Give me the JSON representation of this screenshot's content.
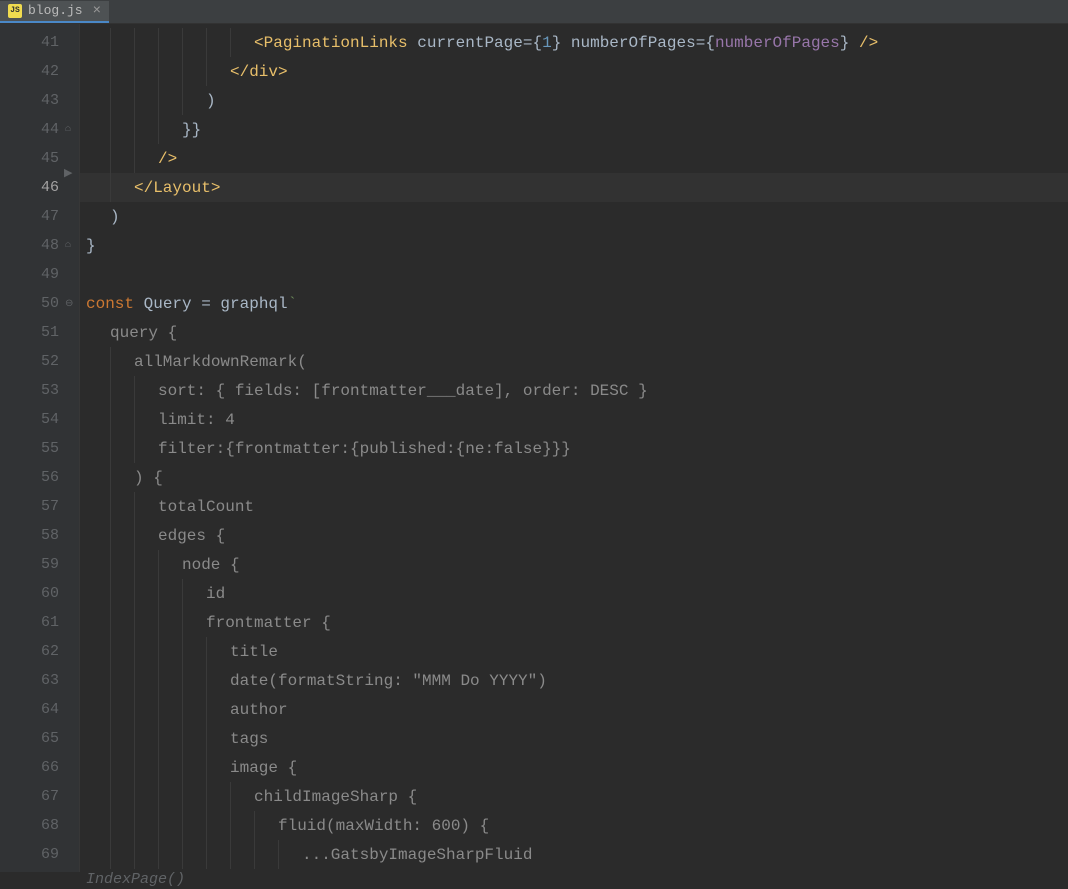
{
  "tab": {
    "filename": "blog.js",
    "icon_text": "JS"
  },
  "lines": {
    "start": 41,
    "end": 69,
    "current": 46
  },
  "code": {
    "l41": {
      "indent": 7,
      "tokens": [
        {
          "t": "<",
          "c": "c-tag"
        },
        {
          "t": "PaginationLinks ",
          "c": "c-tag"
        },
        {
          "t": "currentPage",
          "c": "c-attr"
        },
        {
          "t": "=",
          "c": "c-punc"
        },
        {
          "t": "{",
          "c": "c-brace"
        },
        {
          "t": "1",
          "c": "c-num"
        },
        {
          "t": "} ",
          "c": "c-brace"
        },
        {
          "t": "numberOfPages",
          "c": "c-attr"
        },
        {
          "t": "=",
          "c": "c-punc"
        },
        {
          "t": "{",
          "c": "c-brace"
        },
        {
          "t": "numberOfPages",
          "c": "c-var"
        },
        {
          "t": "} ",
          "c": "c-brace"
        },
        {
          "t": "/>",
          "c": "c-tag"
        }
      ]
    },
    "l42": {
      "indent": 6,
      "tokens": [
        {
          "t": "</",
          "c": "c-tag"
        },
        {
          "t": "div",
          "c": "c-tag"
        },
        {
          "t": ">",
          "c": "c-tag"
        }
      ]
    },
    "l43": {
      "indent": 5,
      "tokens": [
        {
          "t": ")",
          "c": "c-punc"
        }
      ]
    },
    "l44": {
      "indent": 4,
      "tokens": [
        {
          "t": "}}",
          "c": "c-brace"
        }
      ]
    },
    "l45": {
      "indent": 3,
      "tokens": [
        {
          "t": "/>",
          "c": "c-tag"
        }
      ]
    },
    "l46": {
      "indent": 2,
      "tokens": [
        {
          "t": "</",
          "c": "c-tag"
        },
        {
          "t": "Layout",
          "c": "c-tag"
        },
        {
          "t": ">",
          "c": "c-tag"
        }
      ]
    },
    "l47": {
      "indent": 1,
      "tokens": [
        {
          "t": ")",
          "c": "c-punc"
        }
      ]
    },
    "l48": {
      "indent": 0,
      "tokens": [
        {
          "t": "}",
          "c": "c-brace"
        }
      ]
    },
    "l49": {
      "indent": 0,
      "tokens": []
    },
    "l50": {
      "indent": 0,
      "tokens": [
        {
          "t": "const ",
          "c": "c-keyword"
        },
        {
          "t": "Query ",
          "c": "c-default"
        },
        {
          "t": "= ",
          "c": "c-punc"
        },
        {
          "t": "graphql",
          "c": "c-default"
        },
        {
          "t": "`",
          "c": "c-str"
        }
      ]
    },
    "l51": {
      "indent": 1,
      "tokens": [
        {
          "t": "query {",
          "c": "c-graphql"
        }
      ]
    },
    "l52": {
      "indent": 2,
      "tokens": [
        {
          "t": "allMarkdownRemark(",
          "c": "c-graphql"
        }
      ]
    },
    "l53": {
      "indent": 3,
      "tokens": [
        {
          "t": "sort: { fields: [frontmatter___date], order: DESC }",
          "c": "c-graphql"
        }
      ]
    },
    "l54": {
      "indent": 3,
      "tokens": [
        {
          "t": "limit: 4",
          "c": "c-graphql"
        }
      ]
    },
    "l55": {
      "indent": 3,
      "tokens": [
        {
          "t": "filter:{frontmatter:{published:{ne:false}}}",
          "c": "c-graphql"
        }
      ]
    },
    "l56": {
      "indent": 2,
      "tokens": [
        {
          "t": ") {",
          "c": "c-graphql"
        }
      ]
    },
    "l57": {
      "indent": 3,
      "tokens": [
        {
          "t": "totalCount",
          "c": "c-graphql"
        }
      ]
    },
    "l58": {
      "indent": 3,
      "tokens": [
        {
          "t": "edges {",
          "c": "c-graphql"
        }
      ]
    },
    "l59": {
      "indent": 4,
      "tokens": [
        {
          "t": "node {",
          "c": "c-graphql"
        }
      ]
    },
    "l60": {
      "indent": 5,
      "tokens": [
        {
          "t": "id",
          "c": "c-graphql"
        }
      ]
    },
    "l61": {
      "indent": 5,
      "tokens": [
        {
          "t": "frontmatter {",
          "c": "c-graphql"
        }
      ]
    },
    "l62": {
      "indent": 6,
      "tokens": [
        {
          "t": "title",
          "c": "c-graphql"
        }
      ]
    },
    "l63": {
      "indent": 6,
      "tokens": [
        {
          "t": "date(formatString: \"MMM Do YYYY\")",
          "c": "c-graphql"
        }
      ]
    },
    "l64": {
      "indent": 6,
      "tokens": [
        {
          "t": "author",
          "c": "c-graphql"
        }
      ]
    },
    "l65": {
      "indent": 6,
      "tokens": [
        {
          "t": "tags",
          "c": "c-graphql"
        }
      ]
    },
    "l66": {
      "indent": 6,
      "tokens": [
        {
          "t": "image {",
          "c": "c-graphql"
        }
      ]
    },
    "l67": {
      "indent": 7,
      "tokens": [
        {
          "t": "childImageSharp {",
          "c": "c-graphql"
        }
      ]
    },
    "l68": {
      "indent": 8,
      "tokens": [
        {
          "t": "fluid(maxWidth: 600) {",
          "c": "c-graphql"
        }
      ]
    },
    "l69": {
      "indent": 9,
      "tokens": [
        {
          "t": "...GatsbyImageSharpFluid",
          "c": "c-graphql"
        }
      ]
    }
  },
  "hint": "IndexPage()",
  "fold_markers": {
    "44": "end",
    "48": "end",
    "50": "start"
  },
  "caret_row": 46
}
